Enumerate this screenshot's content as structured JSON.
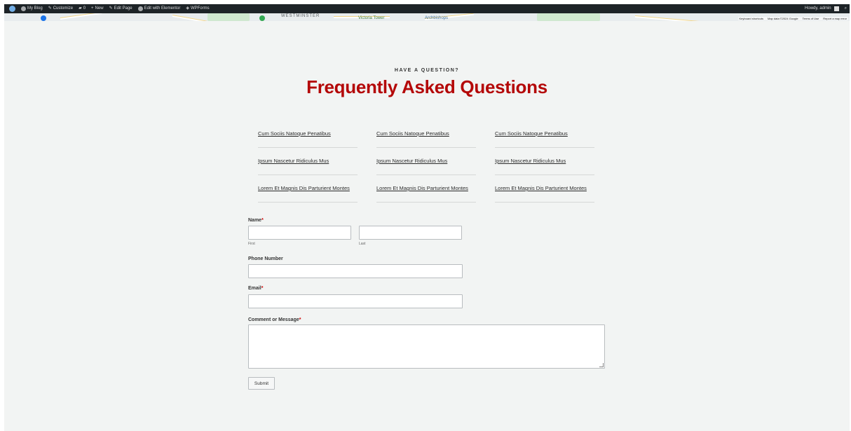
{
  "admin_bar": {
    "items": [
      {
        "icon": "comment-icon",
        "label": "My Blog"
      },
      {
        "icon": "brush-icon",
        "label": "Customize"
      },
      {
        "icon": "comment-icon",
        "label": "0"
      },
      {
        "icon": "plus-icon",
        "label": "New"
      },
      {
        "icon": "edit-icon",
        "label": "Edit Page"
      },
      {
        "icon": "elementor-icon",
        "label": "Edit with Elementor"
      },
      {
        "icon": "diamond-icon",
        "label": "WPForms"
      }
    ],
    "greeting": "Howdy, admin"
  },
  "map": {
    "labels": [
      "WESTMINSTER",
      "Victoria Tower",
      "Archbishops"
    ],
    "legal": [
      "Keyboard shortcuts",
      "Map data ©2024 Google",
      "Terms of Use",
      "Report a map error"
    ]
  },
  "faq": {
    "eyebrow": "HAVE A QUESTION?",
    "title": "Frequently Asked Questions",
    "columns": [
      [
        "Cum Sociis Natoque Penatibus",
        "Ipsum Nascetur Ridiculus Mus",
        "Lorem Et Magnis Dis Parturient Montes"
      ],
      [
        "Cum Sociis Natoque Penatibus",
        "Ipsum Nascetur Ridiculus Mus",
        "Lorem Et Magnis Dis Parturient Montes"
      ],
      [
        "Cum Sociis Natoque Penatibus",
        "Ipsum Nascetur Ridiculus Mus",
        "Lorem Et Magnis Dis Parturient Montes"
      ]
    ]
  },
  "form": {
    "name_label": "Name",
    "first_label": "First",
    "last_label": "Last",
    "phone_label": "Phone Number",
    "email_label": "Email",
    "message_label": "Comment or Message",
    "required_mark": "*",
    "first_value": "",
    "last_value": "",
    "phone_value": "",
    "email_value": "",
    "message_value": "",
    "submit_label": "Submit"
  },
  "colors": {
    "title": "#b40808",
    "admin_bar": "#1d2327",
    "page_bg": "#f2f4f3"
  }
}
